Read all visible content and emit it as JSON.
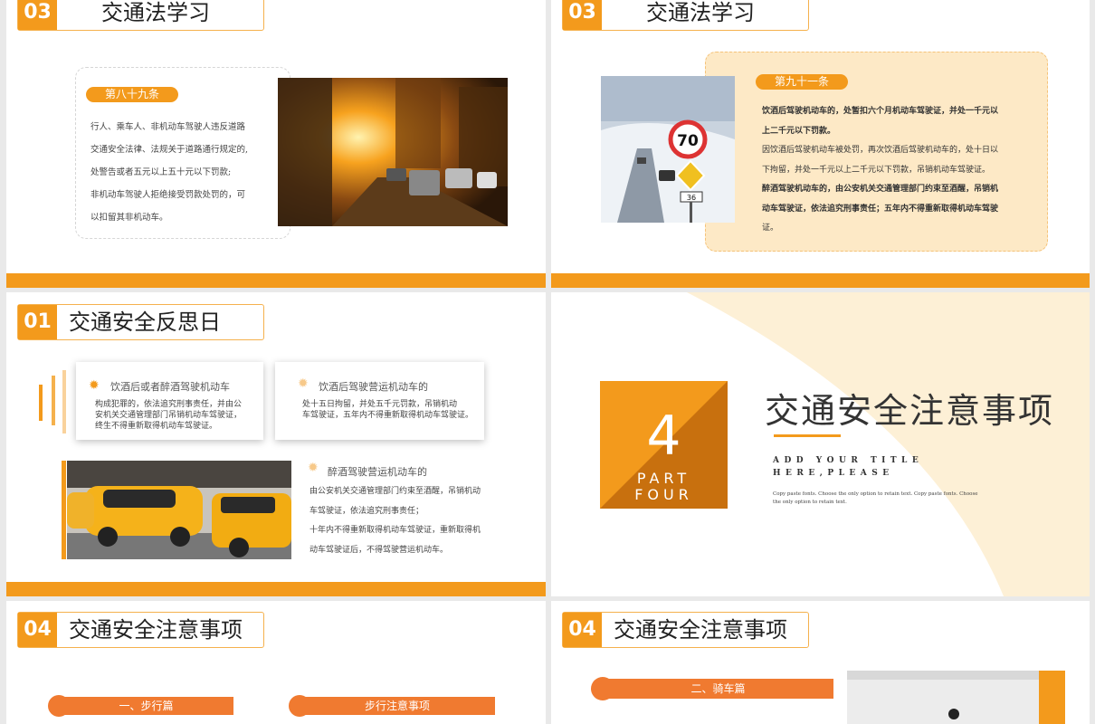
{
  "s1": {
    "num": "03",
    "title": "交通法学习",
    "pill": "第八十九条",
    "lines": [
      "行人、乘车人、非机动车驾驶人违反道路",
      "交通安全法律、法规关于道路通行规定的,",
      "处警告或者五元以上五十元以下罚款;",
      "非机动车驾驶人拒绝接受罚款处罚的，可",
      "以扣留其非机动车。"
    ]
  },
  "s2": {
    "num": "03",
    "title": "交通法学习",
    "pill": "第九十一条",
    "lines": [
      "饮酒后驾驶机动车的，处暂扣六个月机动车驾驶证，并处一千元以",
      "上二千元以下罚款。",
      "因饮酒后驾驶机动车被处罚，再次饮酒后驾驶机动车的，处十日以",
      "下拘留，并处一千元以上二千元以下罚款，吊销机动车驾驶证。",
      "醉酒驾驶机动车的，由公安机关交通管理部门约束至酒醒，吊销机",
      "动车驾驶证，依法追究刑事责任；五年内不得重新取得机动车驾驶",
      "证。"
    ],
    "sign_speed": "70",
    "sign_small": "36"
  },
  "s3": {
    "num": "01",
    "title": "交通安全反思日",
    "card1": {
      "title": "饮酒后或者醉酒驾驶机动车",
      "body": [
        "构成犯罪的，依法追究刑事责任，并由公",
        "安机关交通管理部门吊销机动车驾驶证，",
        "终生不得重新取得机动车驾驶证。"
      ]
    },
    "card2": {
      "title": "饮酒后驾驶营运机动车的",
      "body": [
        "处十五日拘留，并处五千元罚款，吊销机动",
        "车驾驶证，五年内不得重新取得机动车驾驶证。"
      ]
    },
    "block3": {
      "title": "醉酒驾驶营运机动车的",
      "body": [
        "由公安机关交通管理部门约束至酒醒，吊销机动",
        "车驾驶证，依法追究刑事责任；",
        "十年内不得重新取得机动车驾驶证，重新取得机",
        "动车驾驶证后，不得驾驶营运机动车。"
      ]
    }
  },
  "s4": {
    "number": "4",
    "part": "PART",
    "four": "FOUR",
    "title": "交通安全注意事项",
    "sub1": "ADD YOUR TITLE",
    "sub2": "HERE,PLEASE",
    "copy1": "Copy paste fonts. Choose the only option to retain text. Copy paste fonts. Choose",
    "copy2": "the only option to retain text."
  },
  "s5": {
    "num": "04",
    "title": "交通安全注意事项",
    "b1": "一、步行篇",
    "b2": "步行注意事项"
  },
  "s6": {
    "num": "04",
    "title": "交通安全注意事项",
    "b1": "二、骑车篇"
  },
  "colors": {
    "accent": "#f39a1c",
    "accent_dark": "#c8700e",
    "cream": "#fde9c6"
  }
}
